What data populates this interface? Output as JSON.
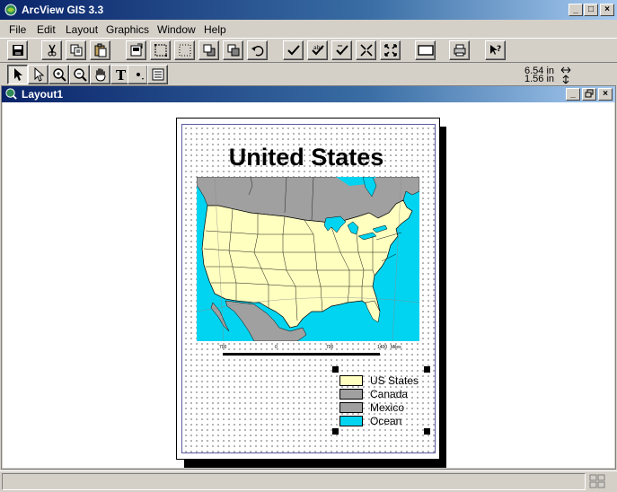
{
  "window": {
    "title": "ArcView GIS 3.3",
    "controls": [
      "_",
      "□",
      "×"
    ]
  },
  "menu": {
    "items": [
      "File",
      "Edit",
      "Layout",
      "Graphics",
      "Window",
      "Help"
    ]
  },
  "coords": {
    "x": "6.54 in",
    "y": "1.56 in"
  },
  "document": {
    "title": "Layout1"
  },
  "layout": {
    "map_title": "United States",
    "scale_labels": [
      "700",
      "0",
      "700",
      "1400",
      "Miles"
    ],
    "legend": [
      {
        "label": "US States",
        "color": "#ffffc0"
      },
      {
        "label": "Canada",
        "color": "#a0a0a0"
      },
      {
        "label": "Mexico",
        "color": "#a0a0a0"
      },
      {
        "label": "Ocean",
        "color": "#00d4f0"
      }
    ]
  },
  "colors": {
    "ocean": "#00d4f0",
    "land_us": "#ffffc0",
    "land_other": "#a0a0a0"
  }
}
